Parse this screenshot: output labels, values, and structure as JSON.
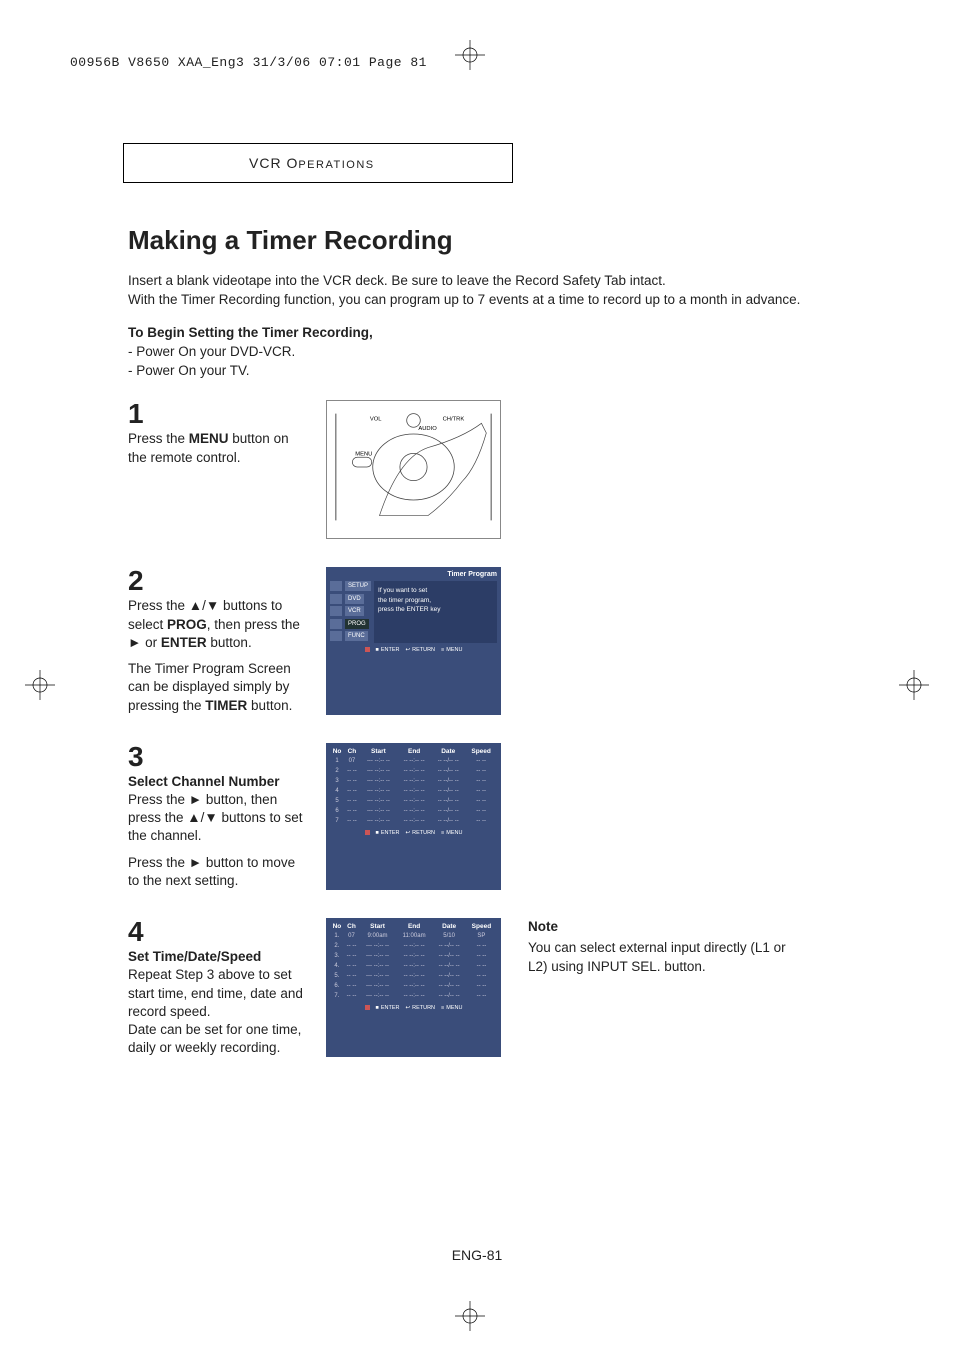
{
  "crop_header": "00956B V8650 XAA_Eng3  31/3/06  07:01  Page 81",
  "section_label_prefix": "VCR O",
  "section_label_suffix": "PERATIONS",
  "title": "Making a Timer Recording",
  "intro_line1": "Insert a blank videotape into the VCR deck. Be sure to leave the Record Safety Tab intact.",
  "intro_line2": "With the Timer Recording function, you can program up to 7 events at a time to record up to a month in advance.",
  "begin_title": "To Begin Setting the Timer Recording,",
  "begin_b1": "- Power On your DVD-VCR.",
  "begin_b2": "- Power On your TV.",
  "step1": {
    "num": "1",
    "text_a": "Press the ",
    "text_bold": "MENU",
    "text_b": " button on the remote control."
  },
  "step2": {
    "num": "2",
    "line1a": "Press the ▲/▼ buttons to select ",
    "line1bold": "PROG",
    "line1b": ", then press the ",
    "line1sym": "►",
    "line1c": " or ",
    "line1bold2": "ENTER",
    "line1d": " button.",
    "line2a": "The Timer Program Screen can be displayed simply by pressing the ",
    "line2bold": "TIMER",
    "line2b": " button."
  },
  "step3": {
    "num": "3",
    "sub": "Select Channel Number",
    "line1": "Press the ► button, then press the ▲/▼ buttons to set the channel.",
    "line2": "Press the ► button to move to the next setting."
  },
  "step4": {
    "num": "4",
    "sub": "Set Time/Date/Speed",
    "line1": "Repeat Step 3 above to set start time, end time, date and record speed.",
    "line2": "Date can be set for one time, daily or weekly recording."
  },
  "note": {
    "title": "Note",
    "body": "You can select external input directly (L1 or L2) using INPUT SEL. button."
  },
  "page_footer": "ENG-81",
  "remote_labels": {
    "vol": "VOL",
    "audio": "AUDIO",
    "menu": "MENU",
    "chtrk": "CH/TRK"
  },
  "screen2": {
    "title": "Timer Program",
    "menu": [
      "SETUP",
      "DVD",
      "VCR",
      "PROG",
      "FUNC"
    ],
    "msg1": "If you want to set",
    "msg2": "the timer program,",
    "msg3": "press the ENTER key",
    "footer": [
      "ENTER",
      "RETURN",
      "MENU"
    ]
  },
  "table_headers": [
    "No",
    "Ch",
    "Start",
    "End",
    "Date",
    "Speed"
  ],
  "table3_rows": [
    [
      "1",
      "07",
      "--- --:-- --",
      "-- --:-- --",
      "-- --/-- --",
      "-- --"
    ],
    [
      "2",
      "-- --",
      "--- --:-- --",
      "-- --:-- --",
      "-- --/-- --",
      "-- --"
    ],
    [
      "3",
      "-- --",
      "--- --:-- --",
      "-- --:-- --",
      "-- --/-- --",
      "-- --"
    ],
    [
      "4",
      "-- --",
      "--- --:-- --",
      "-- --:-- --",
      "-- --/-- --",
      "-- --"
    ],
    [
      "5",
      "-- --",
      "--- --:-- --",
      "-- --:-- --",
      "-- --/-- --",
      "-- --"
    ],
    [
      "6",
      "-- --",
      "--- --:-- --",
      "-- --:-- --",
      "-- --/-- --",
      "-- --"
    ],
    [
      "7",
      "-- --",
      "--- --:-- --",
      "-- --:-- --",
      "-- --/-- --",
      "-- --"
    ]
  ],
  "table4_rows": [
    [
      "1.",
      "07",
      "9:00am",
      "11:00am",
      "5/10",
      "SP"
    ],
    [
      "2.",
      "-- --",
      "--- --:-- --",
      "-- --:-- --",
      "-- --/-- --",
      "-- --"
    ],
    [
      "3.",
      "-- --",
      "--- --:-- --",
      "-- --:-- --",
      "-- --/-- --",
      "-- --"
    ],
    [
      "4.",
      "-- --",
      "--- --:-- --",
      "-- --:-- --",
      "-- --/-- --",
      "-- --"
    ],
    [
      "5.",
      "-- --",
      "--- --:-- --",
      "-- --:-- --",
      "-- --/-- --",
      "-- --"
    ],
    [
      "6.",
      "-- --",
      "--- --:-- --",
      "-- --:-- --",
      "-- --/-- --",
      "-- --"
    ],
    [
      "7.",
      "-- --",
      "--- --:-- --",
      "-- --:-- --",
      "-- --/-- --",
      "-- --"
    ]
  ],
  "table_footer": [
    "ENTER",
    "RETURN",
    "MENU"
  ]
}
